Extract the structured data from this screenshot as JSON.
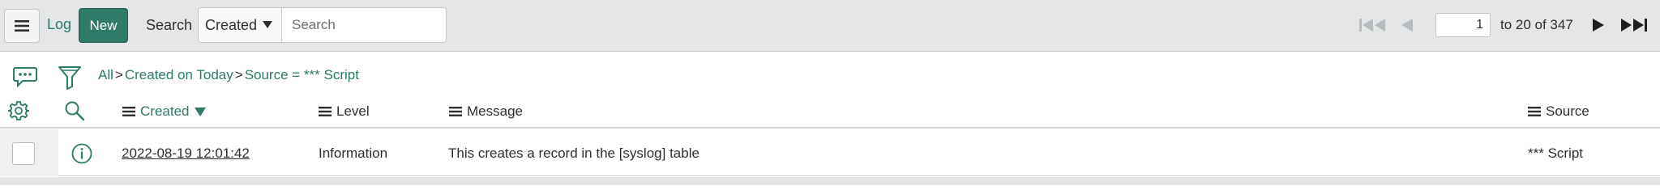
{
  "header": {
    "title": "Log",
    "new_label": "New",
    "search_label": "Search",
    "search_field": {
      "selected": "Created"
    },
    "search_input": {
      "placeholder": "Search",
      "value": ""
    },
    "pager": {
      "page": "1",
      "range_text": "to 20 of 347"
    }
  },
  "filter": {
    "breadcrumb": [
      {
        "label": "All"
      },
      {
        "label": "Created on Today"
      },
      {
        "label": "Source = *** Script"
      }
    ],
    "separator": ">"
  },
  "columns": {
    "created": "Created",
    "level": "Level",
    "message": "Message",
    "source": "Source"
  },
  "rows": [
    {
      "created": "2022-08-19 12:01:42",
      "level": "Information",
      "message": "This creates a record in the [syslog] table",
      "source": "*** Script"
    }
  ],
  "colors": {
    "accent": "#2f7a68",
    "header_bg": "#e4e6e7",
    "link": "#2d7a69"
  }
}
